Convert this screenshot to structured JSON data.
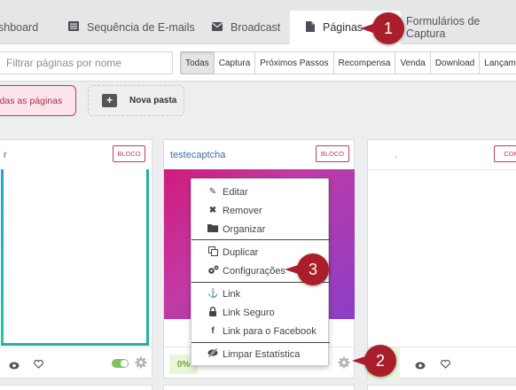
{
  "nav": {
    "tabs": [
      {
        "label": "shboard",
        "icon": "dashboard-icon"
      },
      {
        "label": "Sequência de E-mails",
        "icon": "list-icon"
      },
      {
        "label": "Broadcast",
        "icon": "envelope-icon"
      },
      {
        "label": "Páginas",
        "icon": "file-icon",
        "active": true
      },
      {
        "label": "Formulários de Captura",
        "icon": ""
      }
    ]
  },
  "filter": {
    "placeholder": "Filtrar páginas por nome",
    "buttons": [
      "Todas",
      "Captura",
      "Próximos Passos",
      "Recompensa",
      "Venda",
      "Download",
      "Lançame"
    ],
    "active": "Todas"
  },
  "folders": {
    "all_pages": "odas as páginas",
    "new_folder": "Nova pasta"
  },
  "cards": [
    {
      "title": "r",
      "badge": "BLOCO"
    },
    {
      "title": "testecaptcha",
      "badge": "BLOCO",
      "stat": "0%"
    },
    {
      "title": ".",
      "badge": "COM"
    }
  ],
  "menu": {
    "items": [
      {
        "label": "Editar",
        "icon": "pencil-icon"
      },
      {
        "label": "Remover",
        "icon": "times-icon"
      },
      {
        "label": "Organizar",
        "icon": "folder-icon"
      },
      {
        "label": "Duplicar",
        "icon": "copy-icon"
      },
      {
        "label": "Configurações",
        "icon": "cogs-icon"
      },
      {
        "label": "Link",
        "icon": "anchor-icon"
      },
      {
        "label": "Link Seguro",
        "icon": "lock-icon"
      },
      {
        "label": "Link para o Facebook",
        "icon": "facebook-icon"
      },
      {
        "label": "Limpar Estatística",
        "icon": "eye-slash-icon"
      }
    ]
  },
  "callouts": [
    "1",
    "2",
    "3"
  ],
  "colors": {
    "accent": "#c2385b",
    "callout": "#a91e2a",
    "link": "#3f6fa3",
    "toggle": "#7ec35b"
  }
}
